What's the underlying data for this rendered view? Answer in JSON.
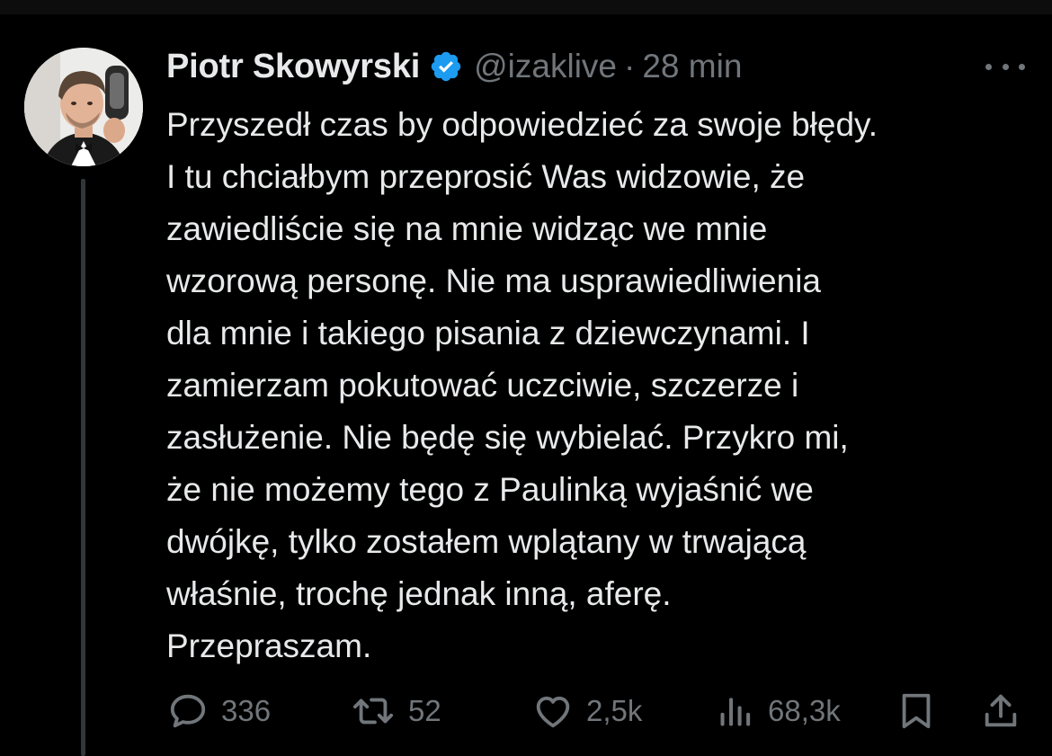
{
  "tweet": {
    "author": {
      "name": "Piotr Skowyrski",
      "handle": "@izaklive",
      "verified": true
    },
    "separator": "·",
    "time": "28 min",
    "text_lines": [
      "Przyszedł czas by odpowiedzieć za swoje błędy.",
      "I tu chciałbym przeprosić Was widzowie, że",
      "zawiedliście się na mnie widząc we mnie",
      "wzorową personę. Nie ma usprawiedliwienia",
      "dla mnie i takiego pisania z dziewczynami. I",
      "zamierzam pokutować uczciwie, szczerze i",
      "zasłużenie. Nie będę się wybielać. Przykro mi,",
      "że nie możemy tego z Paulinką wyjaśnić we",
      "dwójkę, tylko zostałem wplątany w trwającą",
      "właśnie, trochę jednak inną, aferę.",
      "Przepraszam."
    ],
    "stats": {
      "replies": "336",
      "reposts": "52",
      "likes": "2,5k",
      "views": "68,3k"
    }
  },
  "icons": {
    "verified": "verified-badge-icon",
    "more": "more-dots-icon",
    "reply": "speech-bubble-icon",
    "repost": "repost-arrows-icon",
    "like": "heart-icon",
    "views": "bar-chart-icon",
    "bookmark": "bookmark-icon",
    "share": "share-upload-icon"
  },
  "colors": {
    "background": "#000000",
    "text": "#e7e9ea",
    "muted": "#71767b",
    "verified": "#1d9bf0",
    "thread_line": "#333639"
  }
}
